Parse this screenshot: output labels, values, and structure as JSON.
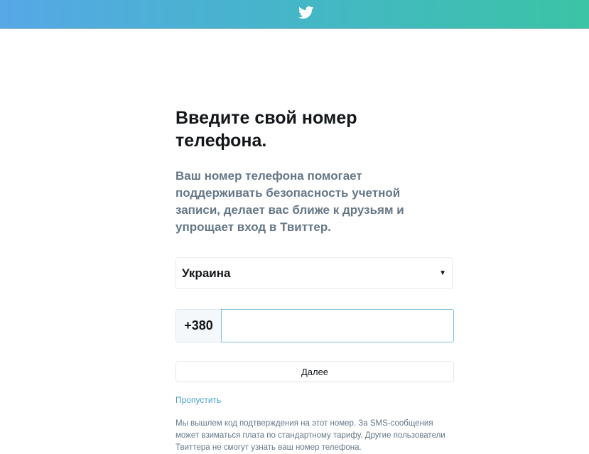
{
  "header": {
    "logo_icon": "twitter-bird-icon",
    "gradient_start": "#56a8e6",
    "gradient_end": "#3bc4a5"
  },
  "main": {
    "title": "Введите свой номер телефона.",
    "subtitle": "Ваш номер телефона помогает поддерживать безопасность учетной записи, делает вас ближе к друзьям и упрощает вход в Твиттер.",
    "country": {
      "selected": "Украина",
      "caret_icon": "chevron-down-icon"
    },
    "phone": {
      "prefix": "+380",
      "value": "",
      "placeholder": ""
    },
    "next_label": "Далее",
    "skip_label": "Пропустить",
    "footnote": "Мы вышлем код подтверждения на этот номер. За SMS-сообщения может взиматься плата по стандартному тарифу. Другие пользователи Твиттера не смогут узнать ваш номер телефона."
  }
}
